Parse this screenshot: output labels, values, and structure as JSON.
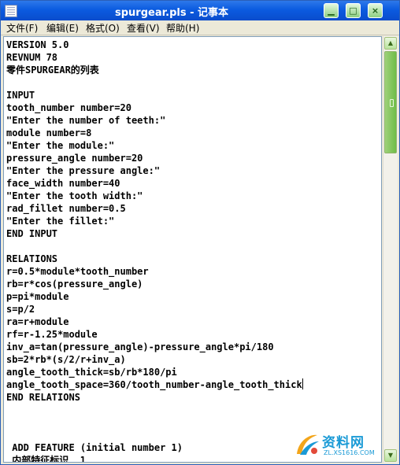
{
  "window": {
    "title": "spurgear.pls - 记事本",
    "controls": {
      "minimize": "▁",
      "maximize": "□",
      "close": "×"
    }
  },
  "menu": {
    "items": [
      {
        "label": "文件(F)",
        "underline": "F"
      },
      {
        "label": "编辑(E)",
        "underline": "E"
      },
      {
        "label": "格式(O)",
        "underline": "O"
      },
      {
        "label": "查看(V)",
        "underline": "V"
      },
      {
        "label": "帮助(H)",
        "underline": "H"
      }
    ]
  },
  "editor": {
    "lines": [
      "VERSION 5.0",
      "REVNUM 78",
      "零件SPURGEAR的列表",
      "",
      "INPUT",
      "tooth_number number=20",
      "\"Enter the number of teeth:\"",
      "module number=8",
      "\"Enter the module:\"",
      "pressure_angle number=20",
      "\"Enter the pressure angle:\"",
      "face_width number=40",
      "\"Enter the tooth width:\"",
      "rad_fillet number=0.5",
      "\"Enter the fillet:\"",
      "END INPUT",
      "",
      "RELATIONS",
      "r=0.5*module*tooth_number",
      "rb=r*cos(pressure_angle)",
      "p=pi*module",
      "s=p/2",
      "ra=r+module",
      "rf=r-1.25*module",
      "inv_a=tan(pressure_angle)-pressure_angle*pi/180",
      "sb=2*rb*(s/2/r+inv_a)",
      "angle_tooth_thick=sb/rb*180/pi",
      "angle_tooth_space=360/tooth_number-angle_tooth_thick",
      "END RELATIONS",
      "",
      "",
      "",
      " ADD FEATURE (initial number 1)",
      " 内部特征标识  1"
    ],
    "caret_line": 27
  },
  "scrollbar": {
    "up_icon": "▲",
    "down_icon": "▼",
    "position": 0.0
  },
  "watermark": {
    "brand": "资料网",
    "url": "ZL.XS1616.COM",
    "accent": "#1a9ad6"
  },
  "colors": {
    "title_blue": "#0b5be0",
    "scroll_green": "#6fbd48"
  }
}
